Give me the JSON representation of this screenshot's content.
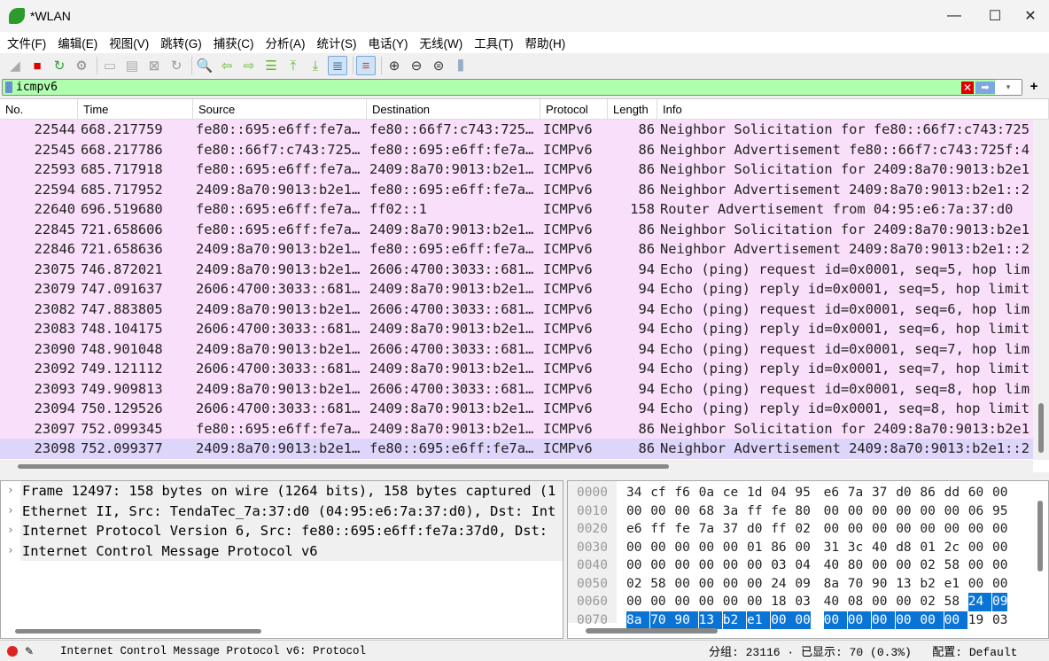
{
  "window": {
    "title": "*WLAN",
    "minimize": "—",
    "maximize": "☐",
    "close": "✕"
  },
  "menu": [
    "文件(F)",
    "编辑(E)",
    "视图(V)",
    "跳转(G)",
    "捕获(C)",
    "分析(A)",
    "统计(S)",
    "电话(Y)",
    "无线(W)",
    "工具(T)",
    "帮助(H)"
  ],
  "toolbar": [
    {
      "name": "start-capture-icon",
      "glyph": "◢",
      "color": "#aaaaaa"
    },
    {
      "name": "stop-capture-icon",
      "glyph": "■",
      "color": "#dd0000"
    },
    {
      "name": "restart-capture-icon",
      "glyph": "↻",
      "color": "#2ca02c"
    },
    {
      "name": "capture-options-icon",
      "glyph": "⚙",
      "color": "#888888"
    },
    {
      "sep": true
    },
    {
      "name": "open-file-icon",
      "glyph": "▭",
      "color": "#aaaaaa"
    },
    {
      "name": "save-file-icon",
      "glyph": "▤",
      "color": "#aaaaaa"
    },
    {
      "name": "close-file-icon",
      "glyph": "⊠",
      "color": "#999999"
    },
    {
      "name": "reload-file-icon",
      "glyph": "↻",
      "color": "#999999"
    },
    {
      "sep": true
    },
    {
      "name": "find-packet-icon",
      "glyph": "🔍",
      "color": "#333333"
    },
    {
      "name": "go-back-icon",
      "glyph": "⇦",
      "color": "#5cb82c"
    },
    {
      "name": "go-forward-icon",
      "glyph": "⇨",
      "color": "#5cb82c"
    },
    {
      "name": "go-to-packet-icon",
      "glyph": "☰",
      "color": "#5cb82c"
    },
    {
      "name": "first-packet-icon",
      "glyph": "⤒",
      "color": "#5cb82c"
    },
    {
      "name": "last-packet-icon",
      "glyph": "⤓",
      "color": "#5cb82c"
    },
    {
      "name": "auto-scroll-icon",
      "glyph": "≣",
      "color": "#336699",
      "active": true
    },
    {
      "sep": true
    },
    {
      "name": "colorize-icon",
      "glyph": "≡",
      "color": "#cc4444",
      "active": true
    },
    {
      "sep": true
    },
    {
      "name": "zoom-in-icon",
      "glyph": "⊕",
      "color": "#333333"
    },
    {
      "name": "zoom-out-icon",
      "glyph": "⊖",
      "color": "#333333"
    },
    {
      "name": "zoom-reset-icon",
      "glyph": "⊜",
      "color": "#333333"
    },
    {
      "name": "resize-columns-icon",
      "glyph": "⫼",
      "color": "#336699"
    }
  ],
  "filter": {
    "value": "icmpv6",
    "clear": "✕",
    "apply": "➡",
    "dropdown": "▾",
    "add": "+"
  },
  "packet_list": {
    "columns": [
      "No.",
      "Time",
      "Source",
      "Destination",
      "Protocol",
      "Length",
      "Info"
    ],
    "rows": [
      [
        "22544",
        "668.217759",
        "fe80::695:e6ff:fe7a…",
        "fe80::66f7:c743:725…",
        "ICMPv6",
        "86",
        "Neighbor Solicitation for fe80::66f7:c743:725"
      ],
      [
        "22545",
        "668.217786",
        "fe80::66f7:c743:725…",
        "fe80::695:e6ff:fe7a…",
        "ICMPv6",
        "86",
        "Neighbor Advertisement fe80::66f7:c743:725f:4"
      ],
      [
        "22593",
        "685.717918",
        "fe80::695:e6ff:fe7a…",
        "2409:8a70:9013:b2e1…",
        "ICMPv6",
        "86",
        "Neighbor Solicitation for 2409:8a70:9013:b2e1"
      ],
      [
        "22594",
        "685.717952",
        "2409:8a70:9013:b2e1…",
        "fe80::695:e6ff:fe7a…",
        "ICMPv6",
        "86",
        "Neighbor Advertisement 2409:8a70:9013:b2e1::2"
      ],
      [
        "22640",
        "696.519680",
        "fe80::695:e6ff:fe7a…",
        "ff02::1",
        "ICMPv6",
        "158",
        "Router Advertisement from 04:95:e6:7a:37:d0"
      ],
      [
        "22845",
        "721.658606",
        "fe80::695:e6ff:fe7a…",
        "2409:8a70:9013:b2e1…",
        "ICMPv6",
        "86",
        "Neighbor Solicitation for 2409:8a70:9013:b2e1"
      ],
      [
        "22846",
        "721.658636",
        "2409:8a70:9013:b2e1…",
        "fe80::695:e6ff:fe7a…",
        "ICMPv6",
        "86",
        "Neighbor Advertisement 2409:8a70:9013:b2e1::2"
      ],
      [
        "23075",
        "746.872021",
        "2409:8a70:9013:b2e1…",
        "2606:4700:3033::681…",
        "ICMPv6",
        "94",
        "Echo (ping) request id=0x0001, seq=5, hop lim"
      ],
      [
        "23079",
        "747.091637",
        "2606:4700:3033::681…",
        "2409:8a70:9013:b2e1…",
        "ICMPv6",
        "94",
        "Echo (ping) reply id=0x0001, seq=5, hop limit"
      ],
      [
        "23082",
        "747.883805",
        "2409:8a70:9013:b2e1…",
        "2606:4700:3033::681…",
        "ICMPv6",
        "94",
        "Echo (ping) request id=0x0001, seq=6, hop lim"
      ],
      [
        "23083",
        "748.104175",
        "2606:4700:3033::681…",
        "2409:8a70:9013:b2e1…",
        "ICMPv6",
        "94",
        "Echo (ping) reply id=0x0001, seq=6, hop limit"
      ],
      [
        "23090",
        "748.901048",
        "2409:8a70:9013:b2e1…",
        "2606:4700:3033::681…",
        "ICMPv6",
        "94",
        "Echo (ping) request id=0x0001, seq=7, hop lim"
      ],
      [
        "23092",
        "749.121112",
        "2606:4700:3033::681…",
        "2409:8a70:9013:b2e1…",
        "ICMPv6",
        "94",
        "Echo (ping) reply id=0x0001, seq=7, hop limit"
      ],
      [
        "23093",
        "749.909813",
        "2409:8a70:9013:b2e1…",
        "2606:4700:3033::681…",
        "ICMPv6",
        "94",
        "Echo (ping) request id=0x0001, seq=8, hop lim"
      ],
      [
        "23094",
        "750.129526",
        "2606:4700:3033::681…",
        "2409:8a70:9013:b2e1…",
        "ICMPv6",
        "94",
        "Echo (ping) reply id=0x0001, seq=8, hop limit"
      ],
      [
        "23097",
        "752.099345",
        "fe80::695:e6ff:fe7a…",
        "2409:8a70:9013:b2e1…",
        "ICMPv6",
        "86",
        "Neighbor Solicitation for 2409:8a70:9013:b2e1"
      ],
      [
        "23098",
        "752.099377",
        "2409:8a70:9013:b2e1…",
        "fe80::695:e6ff:fe7a…",
        "ICMPv6",
        "86",
        "Neighbor Advertisement 2409:8a70:9013:b2e1::2"
      ]
    ],
    "selected_row": 16,
    "row_color": "#fadffa",
    "selected_color": "#ddd5fa"
  },
  "details": [
    "Frame 12497: 158 bytes on wire (1264 bits), 158 bytes captured (1",
    "Ethernet II, Src: TendaTec_7a:37:d0 (04:95:e6:7a:37:d0), Dst: Int",
    "Internet Protocol Version 6, Src: fe80::695:e6ff:fe7a:37d0, Dst: ",
    "Internet Control Message Protocol v6"
  ],
  "bytes": [
    {
      "offset": "0000",
      "hex": [
        "34",
        "cf",
        "f6",
        "0a",
        "ce",
        "1d",
        "04",
        "95",
        "e6",
        "7a",
        "37",
        "d0",
        "86",
        "dd",
        "60",
        "00"
      ]
    },
    {
      "offset": "0010",
      "hex": [
        "00",
        "00",
        "00",
        "68",
        "3a",
        "ff",
        "fe",
        "80",
        "00",
        "00",
        "00",
        "00",
        "00",
        "00",
        "06",
        "95"
      ]
    },
    {
      "offset": "0020",
      "hex": [
        "e6",
        "ff",
        "fe",
        "7a",
        "37",
        "d0",
        "ff",
        "02",
        "00",
        "00",
        "00",
        "00",
        "00",
        "00",
        "00",
        "00"
      ]
    },
    {
      "offset": "0030",
      "hex": [
        "00",
        "00",
        "00",
        "00",
        "00",
        "01",
        "86",
        "00",
        "31",
        "3c",
        "40",
        "d8",
        "01",
        "2c",
        "00",
        "00"
      ]
    },
    {
      "offset": "0040",
      "hex": [
        "00",
        "00",
        "00",
        "00",
        "00",
        "00",
        "03",
        "04",
        "40",
        "80",
        "00",
        "00",
        "02",
        "58",
        "00",
        "00"
      ]
    },
    {
      "offset": "0050",
      "hex": [
        "02",
        "58",
        "00",
        "00",
        "00",
        "00",
        "24",
        "09",
        "8a",
        "70",
        "90",
        "13",
        "b2",
        "e1",
        "00",
        "00"
      ]
    },
    {
      "offset": "0060",
      "hex": [
        "00",
        "00",
        "00",
        "00",
        "00",
        "00",
        "18",
        "03",
        "40",
        "08",
        "00",
        "00",
        "02",
        "58",
        "24",
        "09"
      ]
    },
    {
      "offset": "0070",
      "hex": [
        "8a",
        "70",
        "90",
        "13",
        "b2",
        "e1",
        "00",
        "00",
        "00",
        "00",
        "00",
        "00",
        "00",
        "00",
        "19",
        "03"
      ]
    }
  ],
  "bytes_highlight_start": 110,
  "bytes_highlight_end": 125,
  "status": {
    "text": "Internet Control Message Protocol v6: Protocol",
    "right": "分组: 23116 · 已显示: 70 (0.3%)   配置: Default"
  }
}
